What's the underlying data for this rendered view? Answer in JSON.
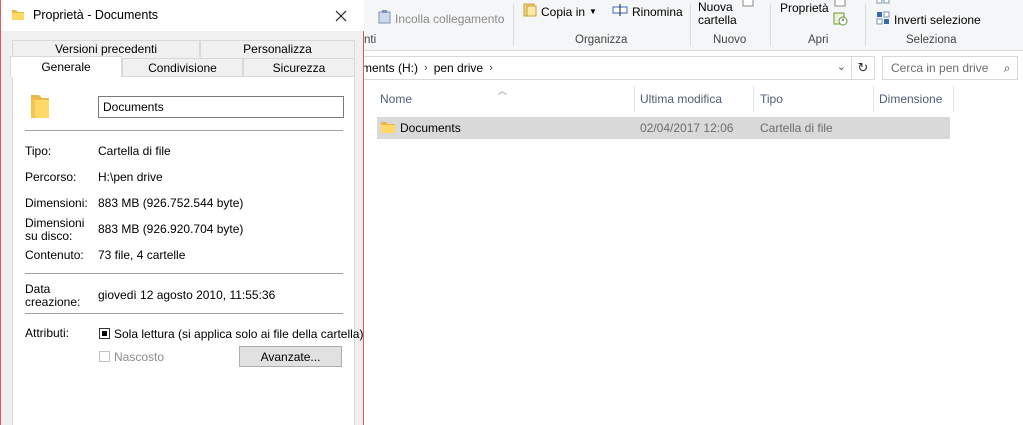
{
  "ribbon": {
    "paste_link": "Incolla collegamento",
    "copy_to": "Copia in",
    "rename": "Rinomina",
    "new_folder_line1": "Nuova",
    "new_folder_line2": "cartella",
    "properties": "Proprietà",
    "invert_selection": "Inverti selezione",
    "group_clipboard_tail": "nti",
    "group_organize": "Organizza",
    "group_new": "Nuovo",
    "group_open": "Apri",
    "group_select": "Seleziona"
  },
  "address": {
    "crumb1": "ments (H:)",
    "crumb2": "pen drive",
    "search_placeholder": "Cerca in pen drive"
  },
  "columns": {
    "name": "Nome",
    "modified": "Ultima modifica",
    "type": "Tipo",
    "size": "Dimensione"
  },
  "file": {
    "name": "Documents",
    "modified": "02/04/2017 12:06",
    "type": "Cartella di file"
  },
  "dialog": {
    "title": "Proprietà - Documents",
    "tabs_top": [
      "Versioni precedenti",
      "Personalizza"
    ],
    "tabs_bottom": [
      "Generale",
      "Condivisione",
      "Sicurezza"
    ],
    "folder_name": "Documents",
    "rows": {
      "type_label": "Tipo:",
      "type_value": "Cartella di file",
      "path_label": "Percorso:",
      "path_value": "H:\\pen drive",
      "size_label": "Dimensioni:",
      "size_value": "883 MB (926.752.544 byte)",
      "disk_label_1": "Dimensioni",
      "disk_label_2": "su disco:",
      "disk_value": "883 MB (926.920.704 byte)",
      "contents_label": "Contenuto:",
      "contents_value": "73 file, 4 cartelle",
      "created_label_1": "Data",
      "created_label_2": "creazione:",
      "created_value": "giovedì 12 agosto 2010, 11:55:36",
      "attributes_label": "Attributi:"
    },
    "readonly_label": "Sola lettura (si applica solo ai file della cartella)",
    "hidden_label": "Nascosto",
    "advanced_button": "Avanzate..."
  },
  "colors": {
    "folder_yellow": "#ffd866",
    "dialog_border": "#e15a5a",
    "selection": "#d9d9d9"
  }
}
